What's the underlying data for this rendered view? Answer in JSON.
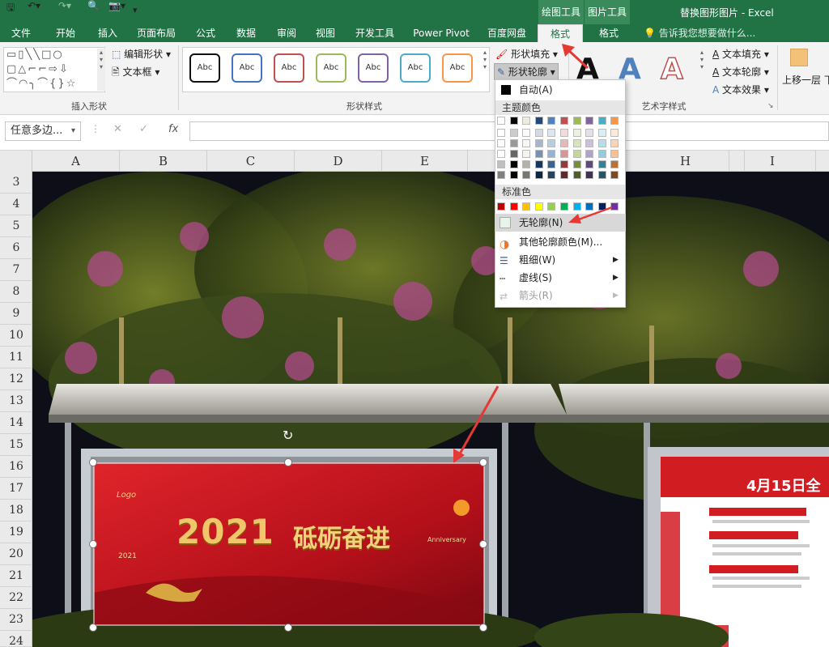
{
  "app": {
    "window_title": "替换图形图片 - Excel",
    "ctx_drawing": "绘图工具",
    "ctx_picture": "图片工具"
  },
  "tabs": [
    "文件",
    "开始",
    "插入",
    "页面布局",
    "公式",
    "数据",
    "审阅",
    "视图",
    "开发工具",
    "Power Pivot",
    "百度网盘",
    "格式",
    "格式"
  ],
  "tell_me": "告诉我您想要做什么...",
  "ribbon": {
    "group_insert_shapes": "插入形状",
    "edit_shape": "编辑形状",
    "text_box": "文本框",
    "group_shape_styles": "形状样式",
    "style_thumb": "Abc",
    "shape_fill": "形状填充",
    "shape_outline": "形状轮廓",
    "group_wordart": "艺术字样式",
    "text_fill": "文本填充",
    "text_outline": "文本轮廓",
    "text_effects": "文本效果",
    "bring_forward": "上移一层",
    "send_backward_partial": "下",
    "wordart_letter": "A"
  },
  "formula_bar": {
    "name_box": "任意多边...",
    "fx": "fx",
    "cancel": "✕",
    "enter": "✓"
  },
  "columns": [
    "A",
    "B",
    "C",
    "D",
    "E",
    "H",
    "I"
  ],
  "rows": [
    "3",
    "4",
    "5",
    "6",
    "7",
    "8",
    "9",
    "10",
    "11",
    "12",
    "13",
    "14",
    "15",
    "16",
    "17",
    "18",
    "19",
    "20",
    "21",
    "22",
    "23",
    "24"
  ],
  "menu": {
    "auto": "自动(A)",
    "theme_colors": "主题颜色",
    "standard_colors": "标准色",
    "no_outline": "无轮廓(N)",
    "more_colors": "其他轮廓颜色(M)...",
    "weight": "粗细(W)",
    "dashes": "虚线(S)",
    "arrows": "箭头(R)"
  },
  "theme_top": [
    "#ffffff",
    "#000000",
    "#e7e6e6",
    "#44546a",
    "#4472c4",
    "#ed7d31",
    "#a5a5a5",
    "#ffc000",
    "#5b9bd5",
    "#70ad47"
  ],
  "theme_top_display": [
    "#ffffff",
    "#000000",
    "#eeece1",
    "#1f497d",
    "#4f81bd",
    "#c0504d",
    "#9bbb59",
    "#8064a2",
    "#4bacc6",
    "#f79646"
  ],
  "standard": [
    "#c00000",
    "#ff0000",
    "#ffc000",
    "#ffff00",
    "#92d050",
    "#00b050",
    "#00b0f0",
    "#0070c0",
    "#002060",
    "#7030a0"
  ],
  "poster": {
    "year": "2021",
    "slogan": "砥砺奋进",
    "logo": "Logo",
    "anniversary": "Anniversary",
    "right_title": "4月15日全"
  },
  "colors": {
    "excel_green": "#217346",
    "poster_red": "#c4121a",
    "arrow_red": "#e53935"
  }
}
